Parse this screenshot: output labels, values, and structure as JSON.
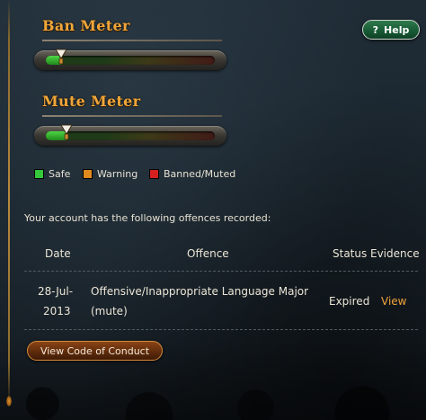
{
  "help_button": {
    "label": "Help",
    "icon": "question-icon"
  },
  "ban_meter": {
    "title": "Ban Meter",
    "level": 0.09,
    "fill_color": "#3fbf3a"
  },
  "mute_meter": {
    "title": "Mute Meter",
    "level": 0.12,
    "fill_color": "#3fbf3a"
  },
  "legend": [
    {
      "label": "Safe",
      "color": "#34c83a"
    },
    {
      "label": "Warning",
      "color": "#e08a1e"
    },
    {
      "label": "Banned/Muted",
      "color": "#d62020"
    }
  ],
  "offences": {
    "intro": "Your account has the following offences recorded:",
    "headers": {
      "date": "Date",
      "offence": "Offence",
      "status": "Status",
      "evidence": "Evidence"
    },
    "rows": [
      {
        "date_line1": "28-Jul-",
        "date_line2": "2013",
        "offence_line1": "Offensive/Inappropriate Language Major",
        "offence_line2": "(mute)",
        "status": "Expired",
        "evidence": "View"
      }
    ]
  },
  "code_of_conduct_button": {
    "label": "View Code of Conduct"
  },
  "colors": {
    "accent_orange": "#f0a63a",
    "help_green": "#175834",
    "background": "#1c2730"
  }
}
